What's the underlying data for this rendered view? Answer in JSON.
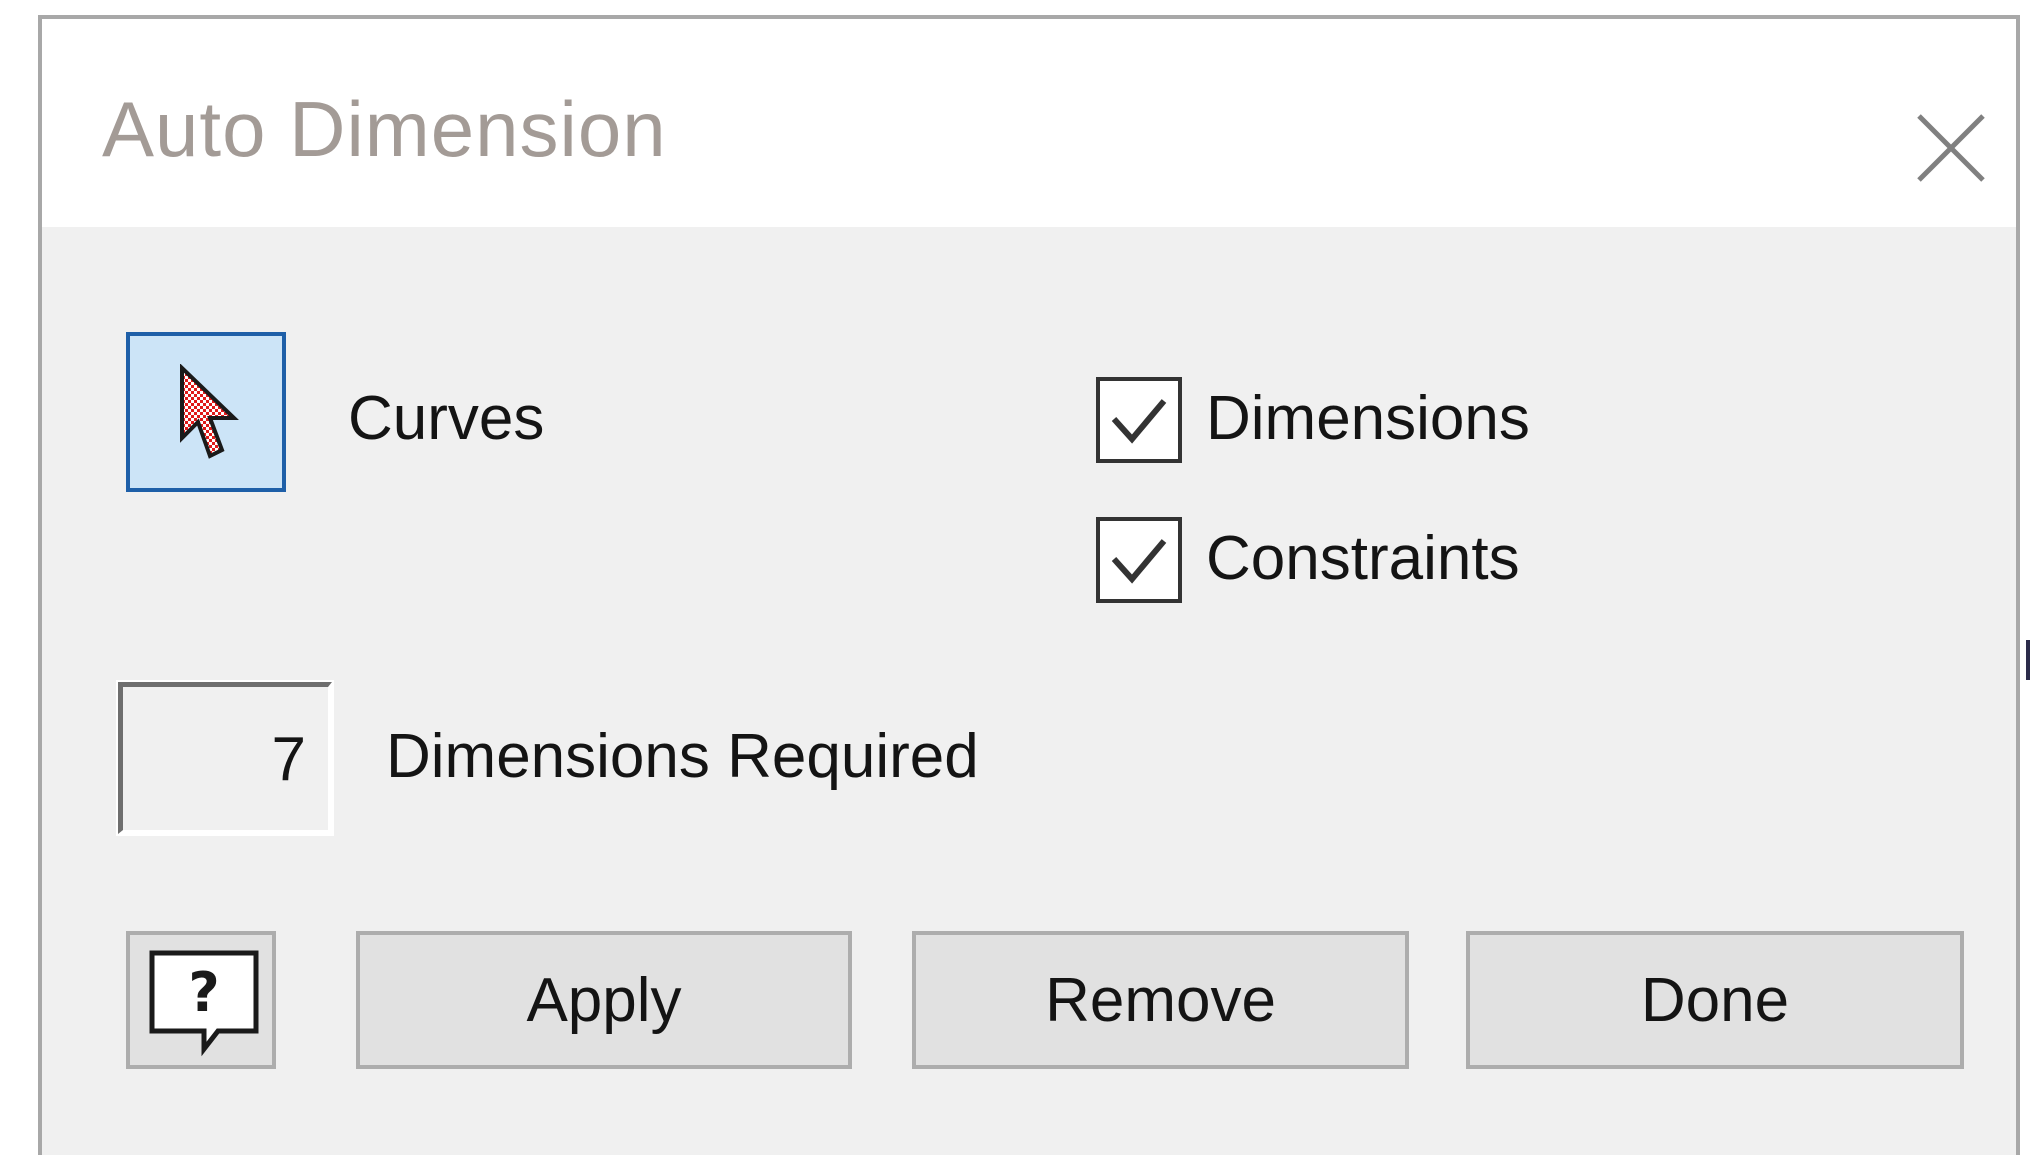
{
  "dialog": {
    "title": "Auto Dimension",
    "close_icon": "close-icon"
  },
  "selection": {
    "icon": "cursor-arrow-icon",
    "label": "Curves"
  },
  "options": [
    {
      "label": "Dimensions",
      "checked": true
    },
    {
      "label": "Constraints",
      "checked": true
    }
  ],
  "required": {
    "value": "7",
    "label": "Dimensions Required"
  },
  "buttons": {
    "help_icon": "help-icon",
    "apply": "Apply",
    "remove": "Remove",
    "done": "Done"
  },
  "colors": {
    "selection_accent": "#1e5fa8",
    "selection_fill": "#cce4f7",
    "dialog_background": "#f0f0f0",
    "button_background": "#e1e1e1"
  }
}
